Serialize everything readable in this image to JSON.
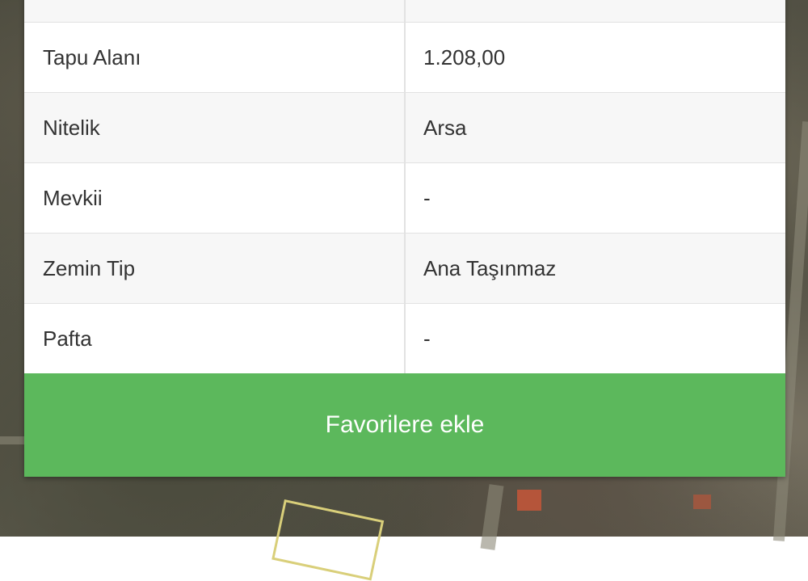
{
  "property_table": {
    "rows": [
      {
        "label": "",
        "value": ""
      },
      {
        "label": "Tapu Alanı",
        "value": "1.208,00"
      },
      {
        "label": "Nitelik",
        "value": "Arsa"
      },
      {
        "label": "Mevkii",
        "value": "-"
      },
      {
        "label": "Zemin Tip",
        "value": "Ana Taşınmaz"
      },
      {
        "label": "Pafta",
        "value": "-"
      }
    ]
  },
  "actions": {
    "favorite_label": "Favorilere ekle"
  },
  "colors": {
    "button_green": "#5cb85c",
    "parcel_outline": "#d9cf7a"
  }
}
